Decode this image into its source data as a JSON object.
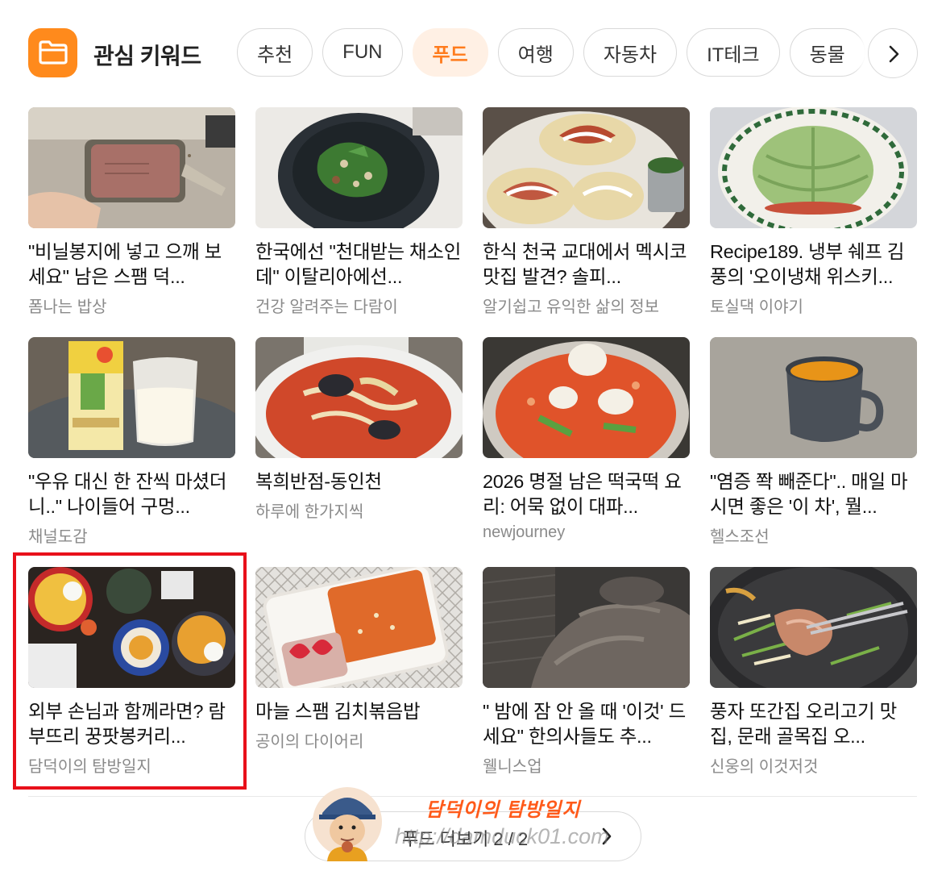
{
  "header": {
    "title": "관심 키워드",
    "icon": "folder-icon",
    "accent": "#ff8a1c"
  },
  "chips": [
    {
      "label": "추천",
      "active": false
    },
    {
      "label": "FUN",
      "active": false
    },
    {
      "label": "푸드",
      "active": true
    },
    {
      "label": "여행",
      "active": false
    },
    {
      "label": "자동차",
      "active": false
    },
    {
      "label": "IT테크",
      "active": false
    },
    {
      "label": "동물",
      "active": false
    }
  ],
  "cards": [
    {
      "title": "\"비닐봉지에 넣고 으깨 보세요\" 남은 스팸 덕...",
      "source": "폼나는 밥상",
      "image": "canned-meat-photo"
    },
    {
      "title": "한국에선 \"천대받는 채소인데\" 이탈리아에선...",
      "source": "건강 알려주는 다람이",
      "image": "herb-salad-bowl-photo"
    },
    {
      "title": "한식 천국 교대에서 멕시코 맛집 발견? 솔피...",
      "source": "알기쉽고 유익한 삶의 정보",
      "image": "tacos-photo"
    },
    {
      "title": "Recipe189. 냉부 쉐프 김풍의 '오이냉채 위스키...",
      "source": "토실댁 이야기",
      "image": "cucumber-dome-photo"
    },
    {
      "title": "\"우유 대신 한 잔씩 마셨더니..\" 나이들어 구멍...",
      "source": "채널도감",
      "image": "soy-milk-photo"
    },
    {
      "title": "복희반점-동인천",
      "source": "하루에 한가지씩",
      "image": "jjamppong-photo"
    },
    {
      "title": "2026 명절 남은 떡국떡 요리: 어묵 없이 대파...",
      "source": "newjourney",
      "image": "tteokbokki-photo"
    },
    {
      "title": "\"염증 쫙 빼준다\".. 매일 마시면 좋은 '이 차', 뭘...",
      "source": "헬스조선",
      "image": "tea-cup-photo"
    },
    {
      "title": "외부 손님과 함께라면? 람부뜨리 꿍팟봉커리...",
      "source": "담덕이의 탐방일지",
      "image": "thai-table-photo",
      "highlighted": true
    },
    {
      "title": "마늘 스팸 김치볶음밥",
      "source": "공이의 다이어리",
      "image": "lunchbox-photo"
    },
    {
      "title": "\" 밤에 잠 안 올 때 '이것' 드세요\" 한의사들도 추...",
      "source": "웰니스업",
      "image": "bed-blanket-photo"
    },
    {
      "title": "풍자 또간집 오리고기 맛집, 문래 골목집 오...",
      "source": "신웅의 이것저것",
      "image": "duck-grill-photo"
    }
  ],
  "more": {
    "label": "푸드 더보기 2 / 2"
  },
  "watermark": {
    "title": "담덕이의 탐방일지",
    "url": "http://damduck01.com"
  },
  "colors": {
    "highlight": "#e8101a",
    "chip_active_bg": "#fff0e4",
    "chip_active_text": "#ff7b1c"
  }
}
